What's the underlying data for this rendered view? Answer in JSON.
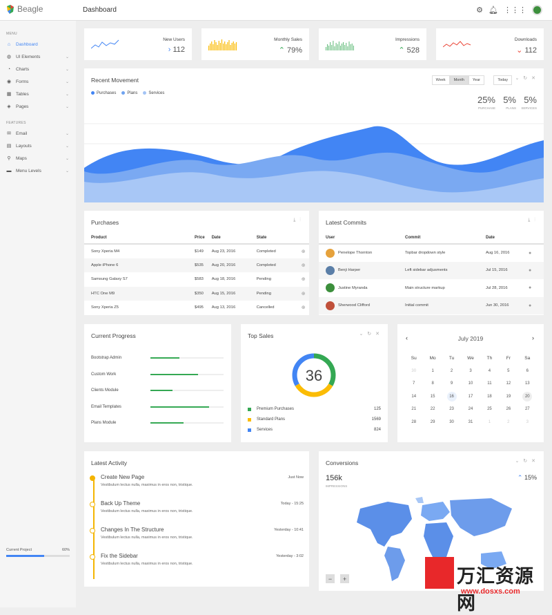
{
  "app": {
    "name": "Beagle",
    "page_title": "Dashboard"
  },
  "topbar": {
    "icons": [
      "gear-icon",
      "bell-icon",
      "apps-grid-icon",
      "avatar"
    ]
  },
  "sidebar": {
    "menu_label": "MENU",
    "menu": [
      {
        "label": "Dashboard",
        "icon": "home-icon",
        "active": true
      },
      {
        "label": "UI Elements",
        "icon": "palette-icon"
      },
      {
        "label": "Charts",
        "icon": "chart-icon"
      },
      {
        "label": "Forms",
        "icon": "radio-icon"
      },
      {
        "label": "Tables",
        "icon": "table-icon"
      },
      {
        "label": "Pages",
        "icon": "layers-icon"
      }
    ],
    "features_label": "FEATURES",
    "features": [
      {
        "label": "Email",
        "icon": "inbox-icon"
      },
      {
        "label": "Layouts",
        "icon": "layout-icon"
      },
      {
        "label": "Maps",
        "icon": "pin-icon"
      },
      {
        "label": "Menu Levels",
        "icon": "folder-icon"
      }
    ],
    "project": {
      "label": "Current Project",
      "percent": "60%",
      "progress": 0.6
    }
  },
  "stats": [
    {
      "label": "New Users",
      "value": "112",
      "trend": "right",
      "color": "#4285f4"
    },
    {
      "label": "Monthly Sales",
      "value": "79%",
      "trend": "up",
      "color": "#fbbc05"
    },
    {
      "label": "Impressions",
      "value": "528",
      "trend": "up",
      "color": "#34a853"
    },
    {
      "label": "Downloads",
      "value": "112",
      "trend": "down",
      "color": "#ea4335"
    }
  ],
  "recent_movement": {
    "title": "Recent Movement",
    "legend": [
      {
        "label": "Purchases",
        "color": "#4285f4"
      },
      {
        "label": "Plans",
        "color": "#6fa3f0"
      },
      {
        "label": "Services",
        "color": "#a3c4f5"
      }
    ],
    "buttons": [
      "Week",
      "Month",
      "Year"
    ],
    "selected": "Month",
    "today": "Today",
    "stats": [
      {
        "value": "25%",
        "label": "PURCHASE"
      },
      {
        "value": "5%",
        "label": "PLANS"
      },
      {
        "value": "5%",
        "label": "SERVICES"
      }
    ]
  },
  "purchases": {
    "title": "Purchases",
    "columns": [
      "Product",
      "Price",
      "Date",
      "State"
    ],
    "rows": [
      {
        "product": "Sony Xperia M4",
        "price": "$149",
        "date": "Aug 23, 2016",
        "state": "Completed",
        "cls": "st-ok"
      },
      {
        "product": "Apple iPhone 6",
        "price": "$535",
        "date": "Aug 20, 2016",
        "state": "Completed",
        "cls": "st-ok"
      },
      {
        "product": "Samsung Galaxy S7",
        "price": "$583",
        "date": "Aug 18, 2016",
        "state": "Pending",
        "cls": "st-pend"
      },
      {
        "product": "HTC One M9",
        "price": "$350",
        "date": "Aug 15, 2016",
        "state": "Pending",
        "cls": "st-pend"
      },
      {
        "product": "Sony Xperia Z5",
        "price": "$495",
        "date": "Aug 13, 2016",
        "state": "Cancelled",
        "cls": "st-can"
      }
    ]
  },
  "commits": {
    "title": "Latest Commits",
    "columns": [
      "User",
      "Commit",
      "Date"
    ],
    "rows": [
      {
        "user": "Penelope Thornton",
        "commit": "Topbar dropdown style",
        "date": "Aug 16, 2016",
        "avatar": "#e6a23c"
      },
      {
        "user": "Benji Harper",
        "commit": "Left sidebar adjusments",
        "date": "Jul 15, 2016",
        "avatar": "#5b7fa8"
      },
      {
        "user": "Justine Myranda",
        "commit": "Main structure markup",
        "date": "Jul 28, 2016",
        "avatar": "#3c8f3c"
      },
      {
        "user": "Sherwood Clifford",
        "commit": "Initial commit",
        "date": "Jun 30, 2016",
        "avatar": "#c0503a"
      }
    ]
  },
  "current_progress": {
    "title": "Current Progress",
    "items": [
      {
        "label": "Bootstrap Admin",
        "value": 0.4
      },
      {
        "label": "Custom Work",
        "value": 0.65
      },
      {
        "label": "Clients Module",
        "value": 0.3
      },
      {
        "label": "Email Templates",
        "value": 0.8
      },
      {
        "label": "Plans Module",
        "value": 0.45
      }
    ]
  },
  "top_sales": {
    "title": "Top Sales",
    "center": "36",
    "items": [
      {
        "label": "Premium Purchases",
        "value": "125",
        "color": "#34a853"
      },
      {
        "label": "Standard Plans",
        "value": "1569",
        "color": "#fbbc05"
      },
      {
        "label": "Services",
        "value": "824",
        "color": "#4285f4"
      }
    ]
  },
  "calendar": {
    "month": "July 2019",
    "days": [
      "Su",
      "Mo",
      "Tu",
      "We",
      "Th",
      "Fr",
      "Sa"
    ],
    "cells": [
      "30",
      "1",
      "2",
      "3",
      "4",
      "5",
      "6",
      "7",
      "8",
      "9",
      "10",
      "11",
      "12",
      "13",
      "14",
      "15",
      "16",
      "17",
      "18",
      "19",
      "20",
      "21",
      "22",
      "23",
      "24",
      "25",
      "26",
      "27",
      "28",
      "29",
      "30",
      "31",
      "1",
      "2",
      "3"
    ]
  },
  "activity": {
    "title": "Latest Activity",
    "items": [
      {
        "title": "Create New Page",
        "desc": "Vestibulum lectus nulla, maximus in eros non, tristique.",
        "time": "Just Now"
      },
      {
        "title": "Back Up Theme",
        "desc": "Vestibulum lectus nulla, maximus in eros non, tristique.",
        "time": "Today - 15:25"
      },
      {
        "title": "Changes In The Structure",
        "desc": "Vestibulum lectus nulla, maximus in eros non, tristique.",
        "time": "Yesterday - 10:41"
      },
      {
        "title": "Fix the Sidebar",
        "desc": "Vestibulum lectus nulla, maximus in eros non, tristique.",
        "time": "Yesterday - 3:02"
      }
    ]
  },
  "conversions": {
    "title": "Conversions",
    "value": "156k",
    "label": "IMPRESSIONS",
    "change": "15%"
  },
  "watermark": {
    "text": "万汇资源网",
    "url": "www.dosxs.com"
  }
}
